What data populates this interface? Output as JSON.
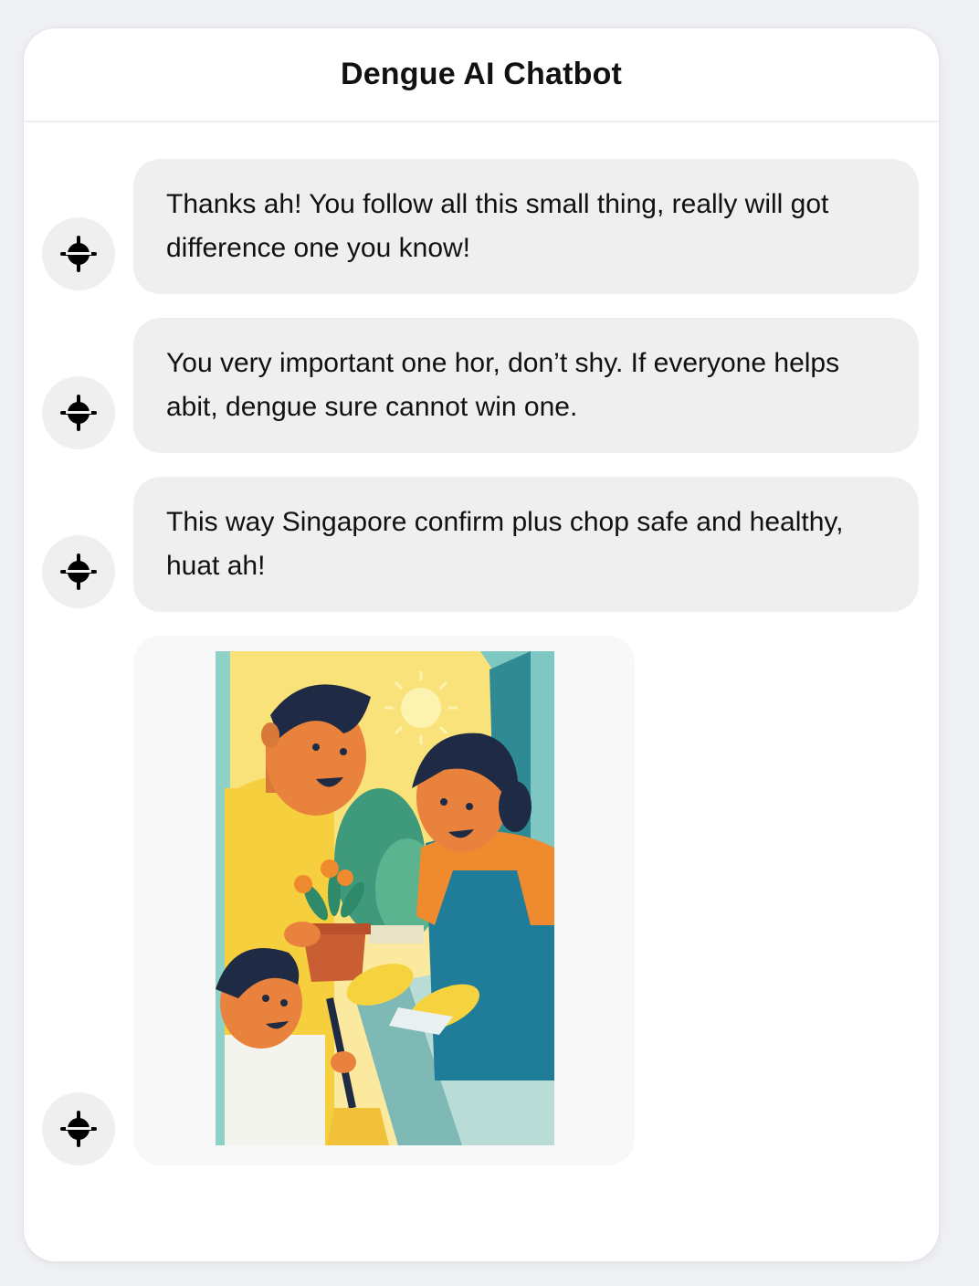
{
  "header": {
    "title": "Dengue AI Chatbot"
  },
  "messages": [
    {
      "sender": "bot",
      "text": "Thanks ah! You follow all this small thing, really will got difference one you know!"
    },
    {
      "sender": "bot",
      "text": "You very important one hor, don’t shy. If everyone helps abit, dengue sure cannot win one."
    },
    {
      "sender": "bot",
      "text": "This way Singapore confirm plus chop safe and healthy, huat ah!"
    },
    {
      "sender": "bot",
      "image": "family-cleaning-home-illustration"
    }
  ],
  "icons": {
    "bot_avatar": "bot-avatar-icon"
  }
}
